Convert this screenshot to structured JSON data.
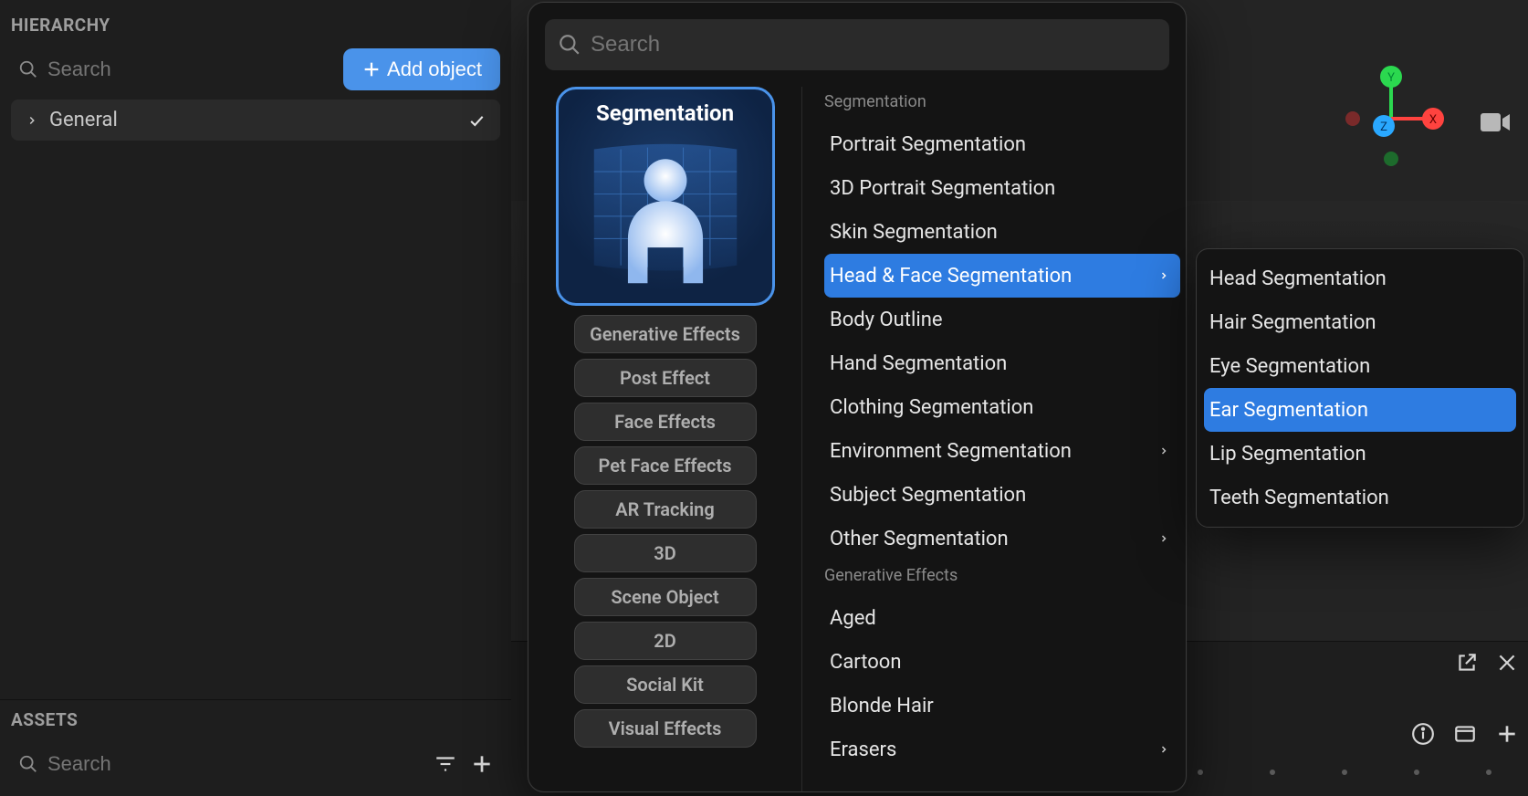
{
  "hierarchy": {
    "title": "HIERARCHY",
    "search_placeholder": "Search",
    "add_object_label": "Add object",
    "root_item": "General"
  },
  "assets": {
    "title": "ASSETS",
    "search_placeholder": "Search"
  },
  "popup": {
    "search_placeholder": "Search",
    "selected_category_title": "Segmentation",
    "category_chips": [
      "Generative Effects",
      "Post Effect",
      "Face Effects",
      "Pet Face Effects",
      "AR Tracking",
      "3D",
      "Scene Object",
      "2D",
      "Social Kit",
      "Visual Effects"
    ],
    "sections": [
      {
        "label": "Segmentation",
        "items": [
          {
            "label": "Portrait Segmentation",
            "has_submenu": false,
            "selected": false
          },
          {
            "label": "3D Portrait Segmentation",
            "has_submenu": false,
            "selected": false
          },
          {
            "label": "Skin Segmentation",
            "has_submenu": false,
            "selected": false
          },
          {
            "label": "Head & Face Segmentation",
            "has_submenu": true,
            "selected": true
          },
          {
            "label": "Body Outline",
            "has_submenu": false,
            "selected": false
          },
          {
            "label": "Hand Segmentation",
            "has_submenu": false,
            "selected": false
          },
          {
            "label": "Clothing Segmentation",
            "has_submenu": false,
            "selected": false
          },
          {
            "label": "Environment Segmentation",
            "has_submenu": true,
            "selected": false
          },
          {
            "label": "Subject Segmentation",
            "has_submenu": false,
            "selected": false
          },
          {
            "label": "Other Segmentation",
            "has_submenu": true,
            "selected": false
          }
        ]
      },
      {
        "label": "Generative Effects",
        "items": [
          {
            "label": "Aged",
            "has_submenu": false,
            "selected": false
          },
          {
            "label": "Cartoon",
            "has_submenu": false,
            "selected": false
          },
          {
            "label": "Blonde Hair",
            "has_submenu": false,
            "selected": false
          },
          {
            "label": "Erasers",
            "has_submenu": true,
            "selected": false
          }
        ]
      }
    ]
  },
  "submenu": {
    "items": [
      {
        "label": "Head Segmentation",
        "selected": false
      },
      {
        "label": "Hair Segmentation",
        "selected": false
      },
      {
        "label": "Eye Segmentation",
        "selected": false
      },
      {
        "label": "Ear Segmentation",
        "selected": true
      },
      {
        "label": "Lip Segmentation",
        "selected": false
      },
      {
        "label": "Teeth Segmentation",
        "selected": false
      }
    ]
  },
  "gizmo": {
    "x": "X",
    "y": "Y",
    "z": "Z"
  }
}
